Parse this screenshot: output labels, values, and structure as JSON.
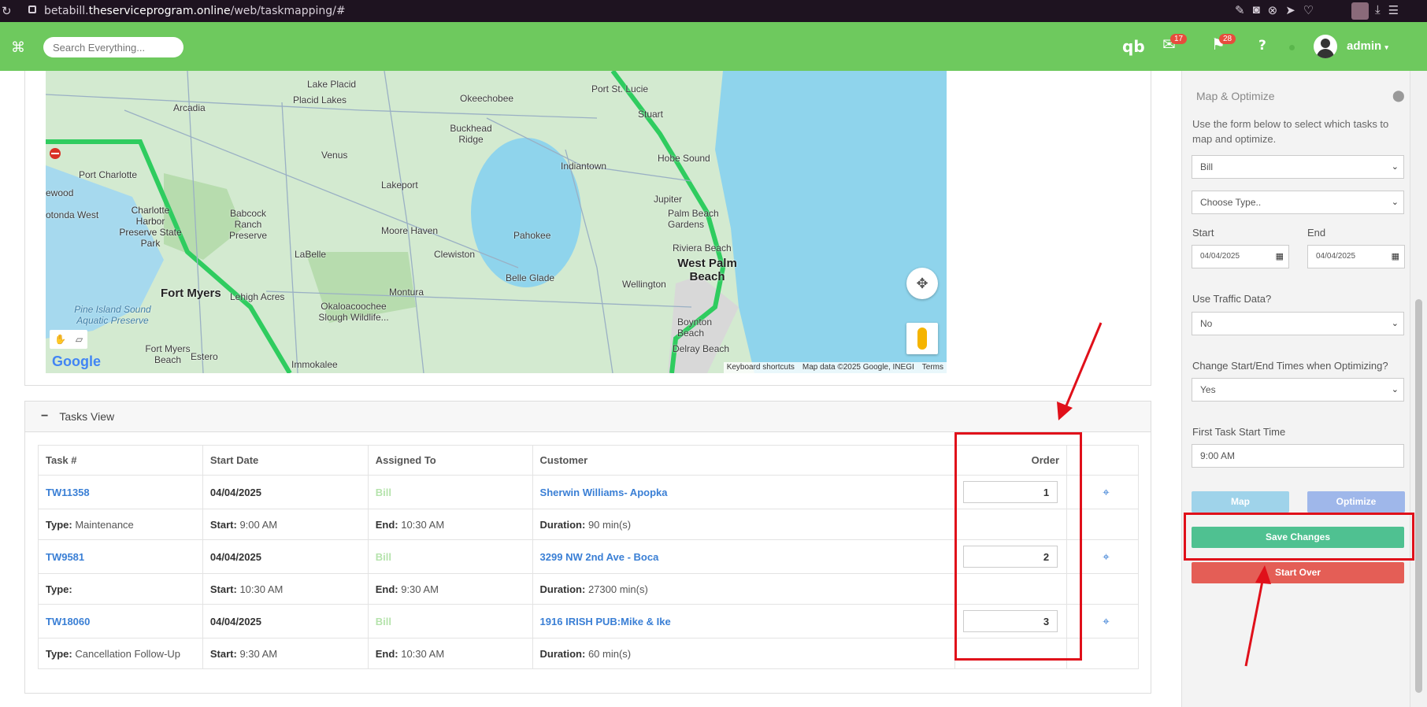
{
  "browser": {
    "url_host_prefix": "betabill.",
    "url_host_main": "theserviceprogram.online",
    "url_path": "/web/taskmapping/#"
  },
  "topnav": {
    "search_placeholder": "Search Everything...",
    "mail_count": "17",
    "flag_count": "28",
    "help_label": "?",
    "username": "admin",
    "brand_color": "#6ec95e"
  },
  "map": {
    "labels": {
      "lake_placid": "Lake Placid",
      "placid_lakes": "Placid Lakes",
      "okeechobee": "Okeechobee",
      "port_st_lucie": "Port St. Lucie",
      "stuart": "Stuart",
      "arcadia": "Arcadia",
      "buckhead_ridge": "Buckhead Ridge",
      "hobe_sound": "Hobe Sound",
      "venus": "Venus",
      "indiantown": "Indiantown",
      "port_charlotte": "Port Charlotte",
      "jupiter": "Jupiter",
      "lakeport": "Lakeport",
      "ewood": "ewood",
      "rotonda_west": "otonda West",
      "charlotte_harbor": "Charlotte Harbor Preserve State Park",
      "babcock": "Babcock Ranch Preserve",
      "moore_haven": "Moore Haven",
      "palm_beach_gardens": "Palm Beach Gardens",
      "pahokee": "Pahokee",
      "riviera_beach": "Riviera Beach",
      "labelle": "LaBelle",
      "clewiston": "Clewiston",
      "west_palm_beach": "West Palm Beach",
      "belle_glade": "Belle Glade",
      "wellington": "Wellington",
      "fort_myers": "Fort Myers",
      "lehigh_acres": "Lehigh Acres",
      "montura": "Montura",
      "pine_island": "Pine Island Sound Aquatic Preserve",
      "okaloacoochee": "Okaloacoochee Slough Wildlife...",
      "boynton": "Boynton Beach",
      "fort_myers_beach": "Fort Myers Beach",
      "estero": "Estero",
      "immokalee": "Immokalee",
      "delray_beach": "Delray Beach"
    },
    "google_logo": "Google",
    "attr_shortcuts": "Keyboard shortcuts",
    "attr_data": "Map data ©2025 Google, INEGI",
    "attr_terms": "Terms"
  },
  "tasks": {
    "panel_title": "Tasks View",
    "columns": [
      "Task #",
      "Start Date",
      "Assigned To",
      "Customer",
      "Order"
    ],
    "rows": [
      {
        "task": "TW11358",
        "date": "04/04/2025",
        "assigned": "Bill",
        "customer": "Sherwin Williams- Apopka",
        "order": "1",
        "type_label": "Type:",
        "type": "Maintenance",
        "start_label": "Start:",
        "start": "9:00 AM",
        "end_label": "End:",
        "end": "10:30 AM",
        "duration_label": "Duration:",
        "duration": "90 min(s)"
      },
      {
        "task": "TW9581",
        "date": "04/04/2025",
        "assigned": "Bill",
        "customer": "3299 NW 2nd Ave - Boca",
        "order": "2",
        "type_label": "Type:",
        "type": "",
        "start_label": "Start:",
        "start": "10:30 AM",
        "end_label": "End:",
        "end": "9:30 AM",
        "duration_label": "Duration:",
        "duration": "27300 min(s)"
      },
      {
        "task": "TW18060",
        "date": "04/04/2025",
        "assigned": "Bill",
        "customer": "1916 IRISH PUB:Mike & Ike",
        "order": "3",
        "type_label": "Type:",
        "type": "Cancellation Follow-Up",
        "start_label": "Start:",
        "start": "9:30 AM",
        "end_label": "End:",
        "end": "10:30 AM",
        "duration_label": "Duration:",
        "duration": "60 min(s)"
      }
    ]
  },
  "sidebar": {
    "title": "Map & Optimize",
    "description": "Use the form below to select which tasks to map and optimize.",
    "user_select": "Bill",
    "type_select": "Choose Type..",
    "start_label": "Start",
    "end_label": "End",
    "start_date": "04/04/2025",
    "end_date": "04/04/2025",
    "traffic_label": "Use Traffic Data?",
    "traffic_value": "No",
    "change_times_label": "Change Start/End Times when Optimizing?",
    "change_times_value": "Yes",
    "first_start_label": "First Task Start Time",
    "first_start_value": "9:00 AM",
    "map_button": "Map",
    "optimize_button": "Optimize",
    "save_button": "Save Changes",
    "start_over_button": "Start Over",
    "colors": {
      "map": "#9fd3ea",
      "optimize": "#9fb7ea",
      "save": "#4fc191",
      "start_over": "#e45e56"
    }
  },
  "annotations": {
    "color": "#e0101a"
  }
}
